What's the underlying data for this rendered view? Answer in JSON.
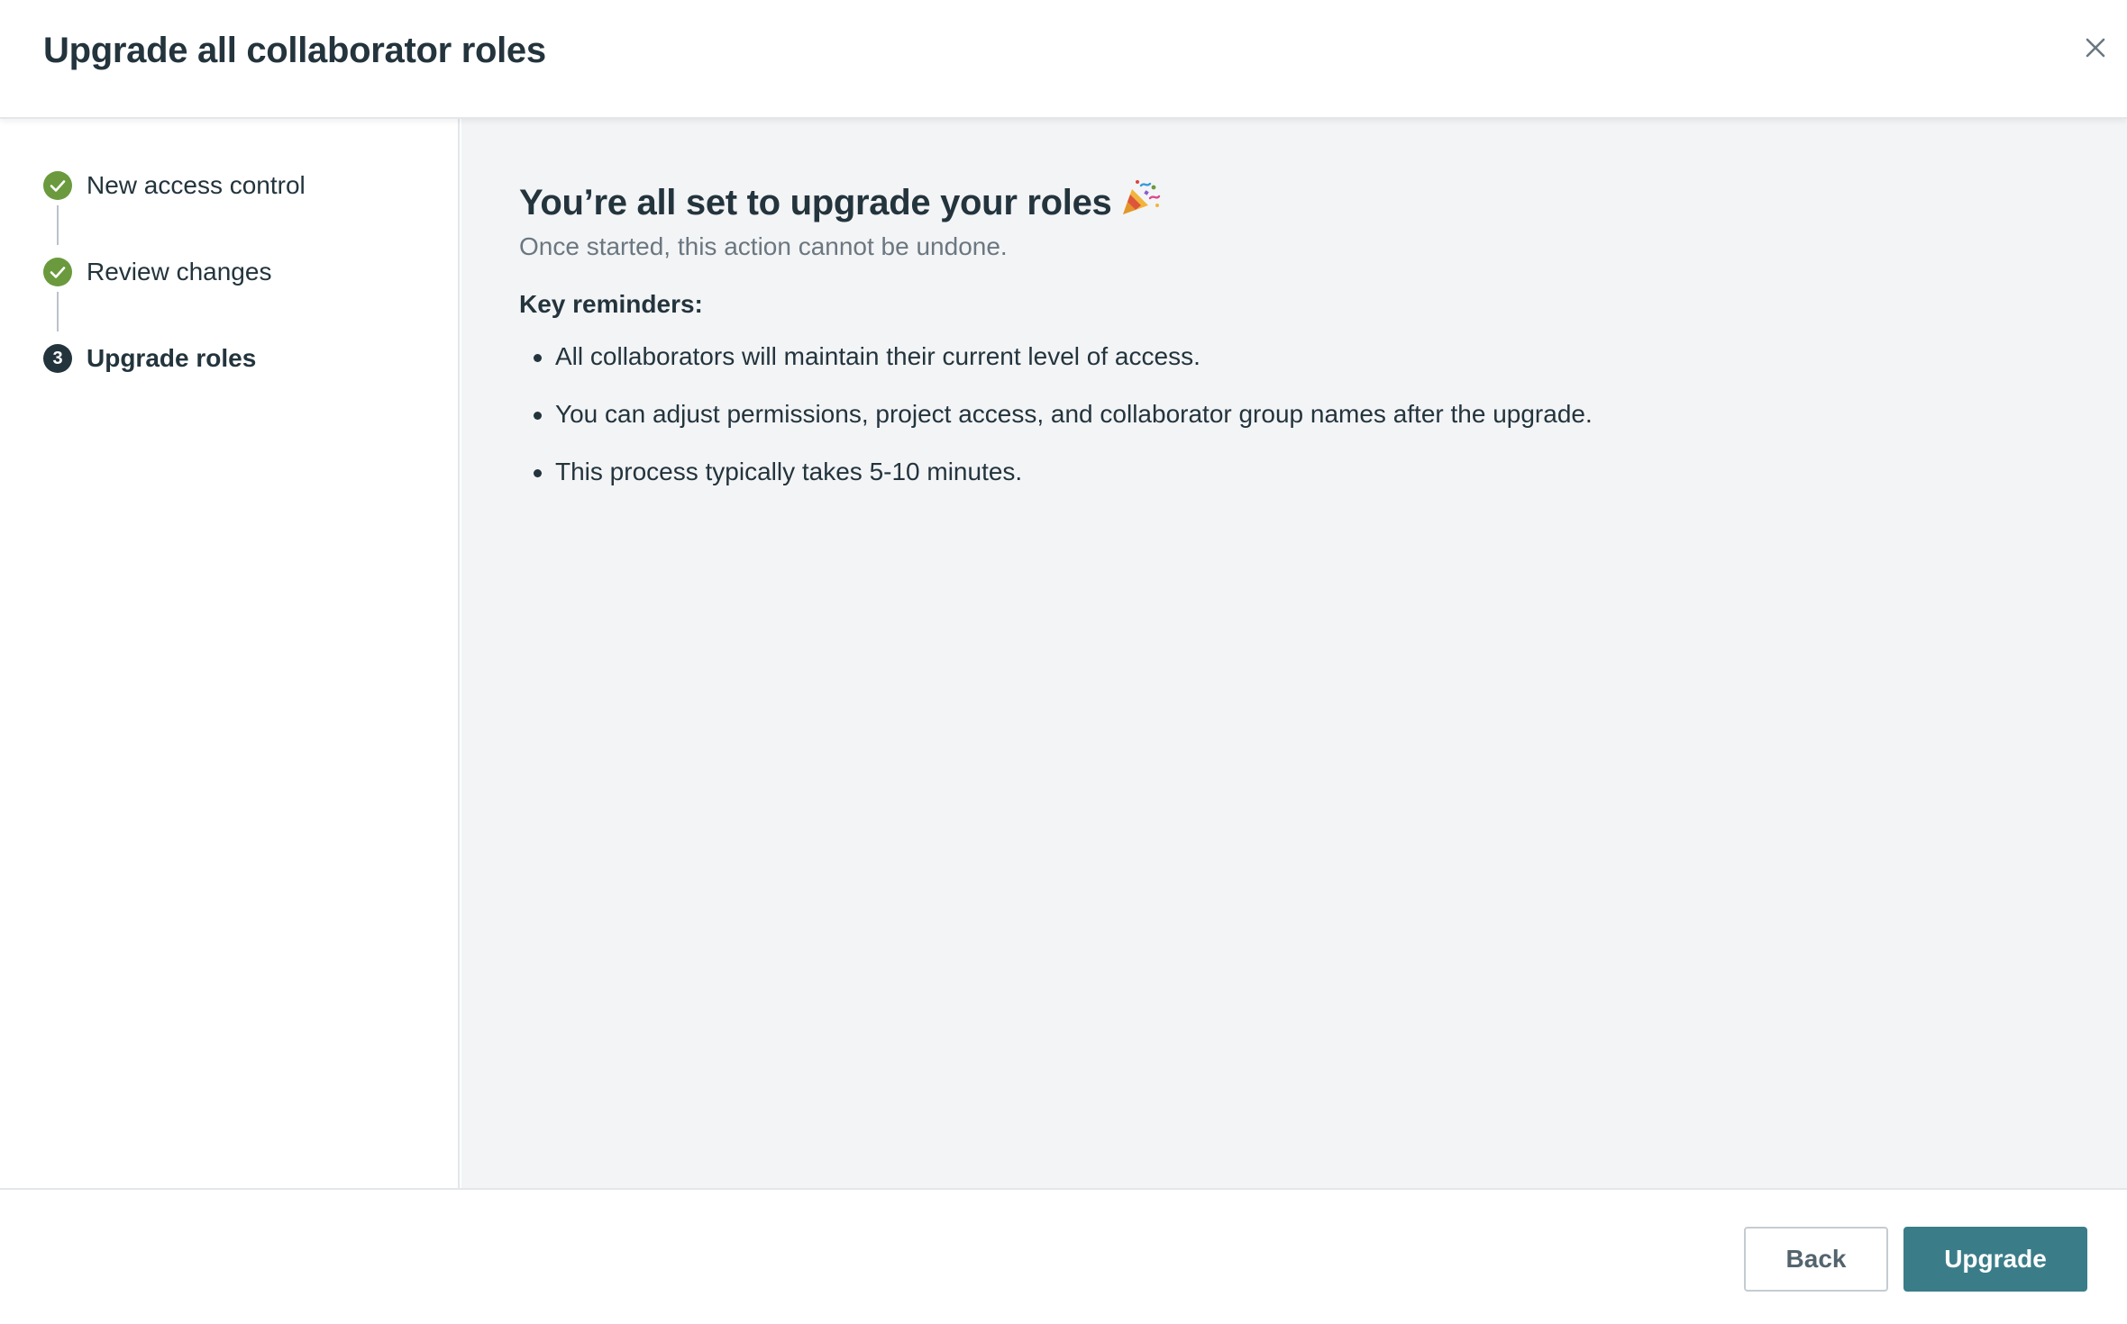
{
  "header": {
    "title": "Upgrade all collaborator roles",
    "close_icon": "close-icon"
  },
  "steps": [
    {
      "label": "New access control",
      "status": "complete",
      "icon": "check-icon"
    },
    {
      "label": "Review changes",
      "status": "complete",
      "icon": "check-icon"
    },
    {
      "label": "Upgrade roles",
      "status": "current",
      "number": "3"
    }
  ],
  "main": {
    "title": "You’re all set to upgrade your roles",
    "title_icon": "party-popper-icon",
    "subtitle": "Once started, this action cannot be undone.",
    "reminders_heading": "Key reminders:",
    "reminders": [
      "All collaborators will maintain their current level of access.",
      "You can adjust permissions, project access, and collaborator group names after the upgrade.",
      "This process typically takes 5-10 minutes."
    ]
  },
  "footer": {
    "back_label": "Back",
    "upgrade_label": "Upgrade"
  },
  "colors": {
    "accent": "#3a7d89",
    "success": "#6a9a3d",
    "text": "#23343d",
    "muted_text": "#6b7780",
    "content_bg": "#f3f4f6"
  }
}
